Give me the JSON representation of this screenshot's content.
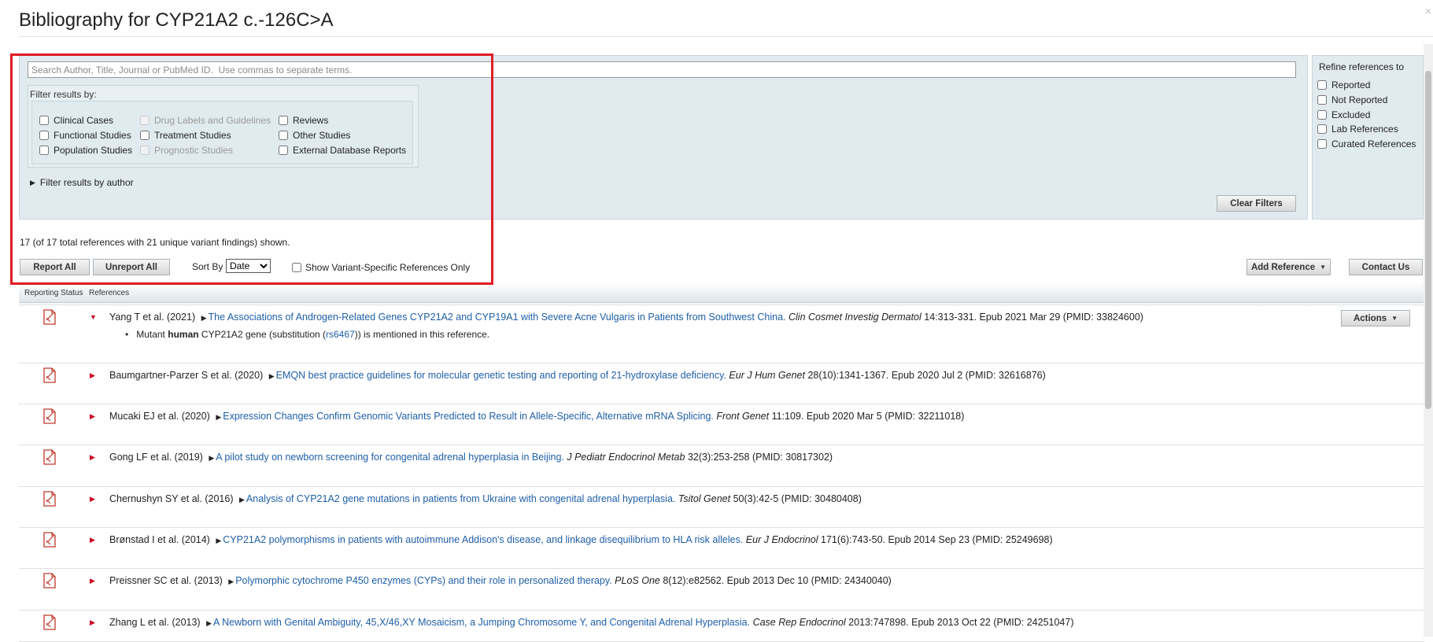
{
  "dialog": {
    "title": "Bibliography for CYP21A2 c.-126C>A",
    "close_symbol": "×"
  },
  "search": {
    "placeholder": "Search Author, Title, Journal or PubMed ID.  Use commas to separate terms.",
    "value": ""
  },
  "filters": {
    "legend": "Filter results by:",
    "clinical_cases": "Clinical Cases",
    "drug_labels": "Drug Labels and Guidelines",
    "reviews": "Reviews",
    "functional_studies": "Functional Studies",
    "treatment_studies": "Treatment Studies",
    "other_studies": "Other Studies",
    "population_studies": "Population Studies",
    "prognostic_studies": "Prognostic Studies",
    "external_db_reports": "External Database Reports",
    "author_toggle": "Filter results by author",
    "clear_filters": "Clear Filters"
  },
  "refine": {
    "title": "Refine references to",
    "reported": "Reported",
    "not_reported": "Not Reported",
    "excluded": "Excluded",
    "lab_references": "Lab References",
    "curated_references": "Curated References"
  },
  "summary": {
    "count_text": "17 (of 17 total references with 21 unique variant findings) shown."
  },
  "toolbar": {
    "report_all": "Report All",
    "unreport_all": "Unreport All",
    "sort_by_label": "Sort By",
    "sort_by_value": "Date",
    "variant_only_label": "Show Variant-Specific References Only",
    "add_reference": "Add Reference",
    "contact_us": "Contact Us"
  },
  "table": {
    "col_status": "Reporting Status",
    "col_references": "References"
  },
  "references": [
    {
      "authors": "Yang T et al. (2021)",
      "title": "The Associations of Androgen-Related Genes CYP21A2 and CYP19A1 with Severe Acne Vulgaris in Patients from Southwest China.",
      "journal": "Clin Cosmet Investig Dermatol",
      "details": "14:313-331. Epub 2021 Mar 29 (PMID: 33824600)",
      "expanded": true,
      "actions_label": "Actions",
      "finding": {
        "prefix": "Mutant ",
        "species": "human",
        "middle": " CYP21A2 gene (substitution (",
        "link": "rs6467",
        "suffix": ")) is mentioned in this reference."
      }
    },
    {
      "authors": "Baumgartner-Parzer S et al. (2020)",
      "title": "EMQN best practice guidelines for molecular genetic testing and reporting of 21-hydroxylase deficiency.",
      "journal": "Eur J Hum Genet",
      "details": "28(10):1341-1367. Epub 2020 Jul 2 (PMID: 32616876)"
    },
    {
      "authors": "Mucaki EJ et al. (2020)",
      "title": "Expression Changes Confirm Genomic Variants Predicted to Result in Allele-Specific, Alternative mRNA Splicing.",
      "journal": "Front Genet",
      "details": "11:109. Epub 2020 Mar 5 (PMID: 32211018)"
    },
    {
      "authors": "Gong LF et al. (2019)",
      "title": "A pilot study on newborn screening for congenital adrenal hyperplasia in Beijing.",
      "journal": "J Pediatr Endocrinol Metab",
      "details": "32(3):253-258 (PMID: 30817302)"
    },
    {
      "authors": "Chernushyn SY et al. (2016)",
      "title": "Analysis of CYP21A2 gene mutations in patients from Ukraine with congenital adrenal hyperplasia.",
      "journal": "Tsitol Genet",
      "details": "50(3):42-5 (PMID: 30480408)"
    },
    {
      "authors": "Brønstad I et al. (2014)",
      "title": "CYP21A2 polymorphisms in patients with autoimmune Addison's disease, and linkage disequilibrium to HLA risk alleles.",
      "journal": "Eur J Endocrinol",
      "details": "171(6):743-50. Epub 2014 Sep 23 (PMID: 25249698)"
    },
    {
      "authors": "Preissner SC et al. (2013)",
      "title": "Polymorphic cytochrome P450 enzymes (CYPs) and their role in personalized therapy.",
      "journal": "PLoS One",
      "details": "8(12):e82562. Epub 2013 Dec 10 (PMID: 24340040)"
    },
    {
      "authors": "Zhang L et al. (2013)",
      "title": "A Newborn with Genital Ambiguity, 45,X/46,XY Mosaicism, a Jumping Chromosome Y, and Congenital Adrenal Hyperplasia.",
      "journal": "Case Rep Endocrinol",
      "details": "2013:747898. Epub 2013 Oct 22 (PMID: 24251047)"
    }
  ]
}
